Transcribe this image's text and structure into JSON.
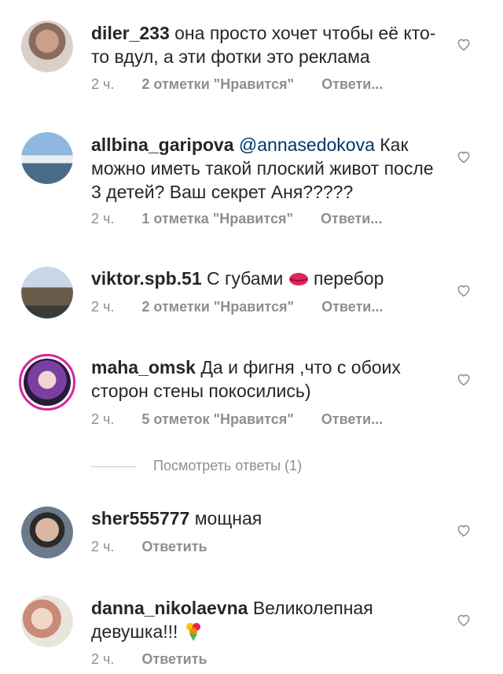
{
  "comments": [
    {
      "username": "diler_233",
      "text": "она просто хочет чтобы её кто-то вдул, а эти фотки это реклама",
      "time": "2 ч.",
      "likes": "2 отметки \"Нравится\"",
      "reply": "Ответи..."
    },
    {
      "username": "allbina_garipova",
      "mention": "@annasedokova",
      "text": "Как можно иметь такой плоский живот после 3 детей? Ваш секрет Аня?????",
      "time": "2 ч.",
      "likes": "1 отметка \"Нравится\"",
      "reply": "Ответи..."
    },
    {
      "username": "viktor.spb.51",
      "text_before": "С губами",
      "emoji": "lips",
      "text_after": "перебор",
      "time": "2 ч.",
      "likes": "2 отметки \"Нравится\"",
      "reply": "Ответи..."
    },
    {
      "username": "maha_omsk",
      "text": "Да и фигня ,что с обоих сторон стены покосились)",
      "time": "2 ч.",
      "likes": "5 отметок \"Нравится\"",
      "reply": "Ответи..."
    },
    {
      "username": "sher555777",
      "text": "мощная",
      "time": "2 ч.",
      "reply": "Ответить"
    },
    {
      "username": "danna_nikolaevna",
      "text": "Великолепная девушка!!!",
      "emoji": "bouquet",
      "time": "2 ч.",
      "reply": "Ответить"
    }
  ],
  "view_replies": "Посмотреть ответы (1)",
  "colors": {
    "text": "#262626",
    "meta": "#8e8e8e",
    "mention": "#003569"
  },
  "icons": {
    "like": "heart-outline-icon"
  }
}
